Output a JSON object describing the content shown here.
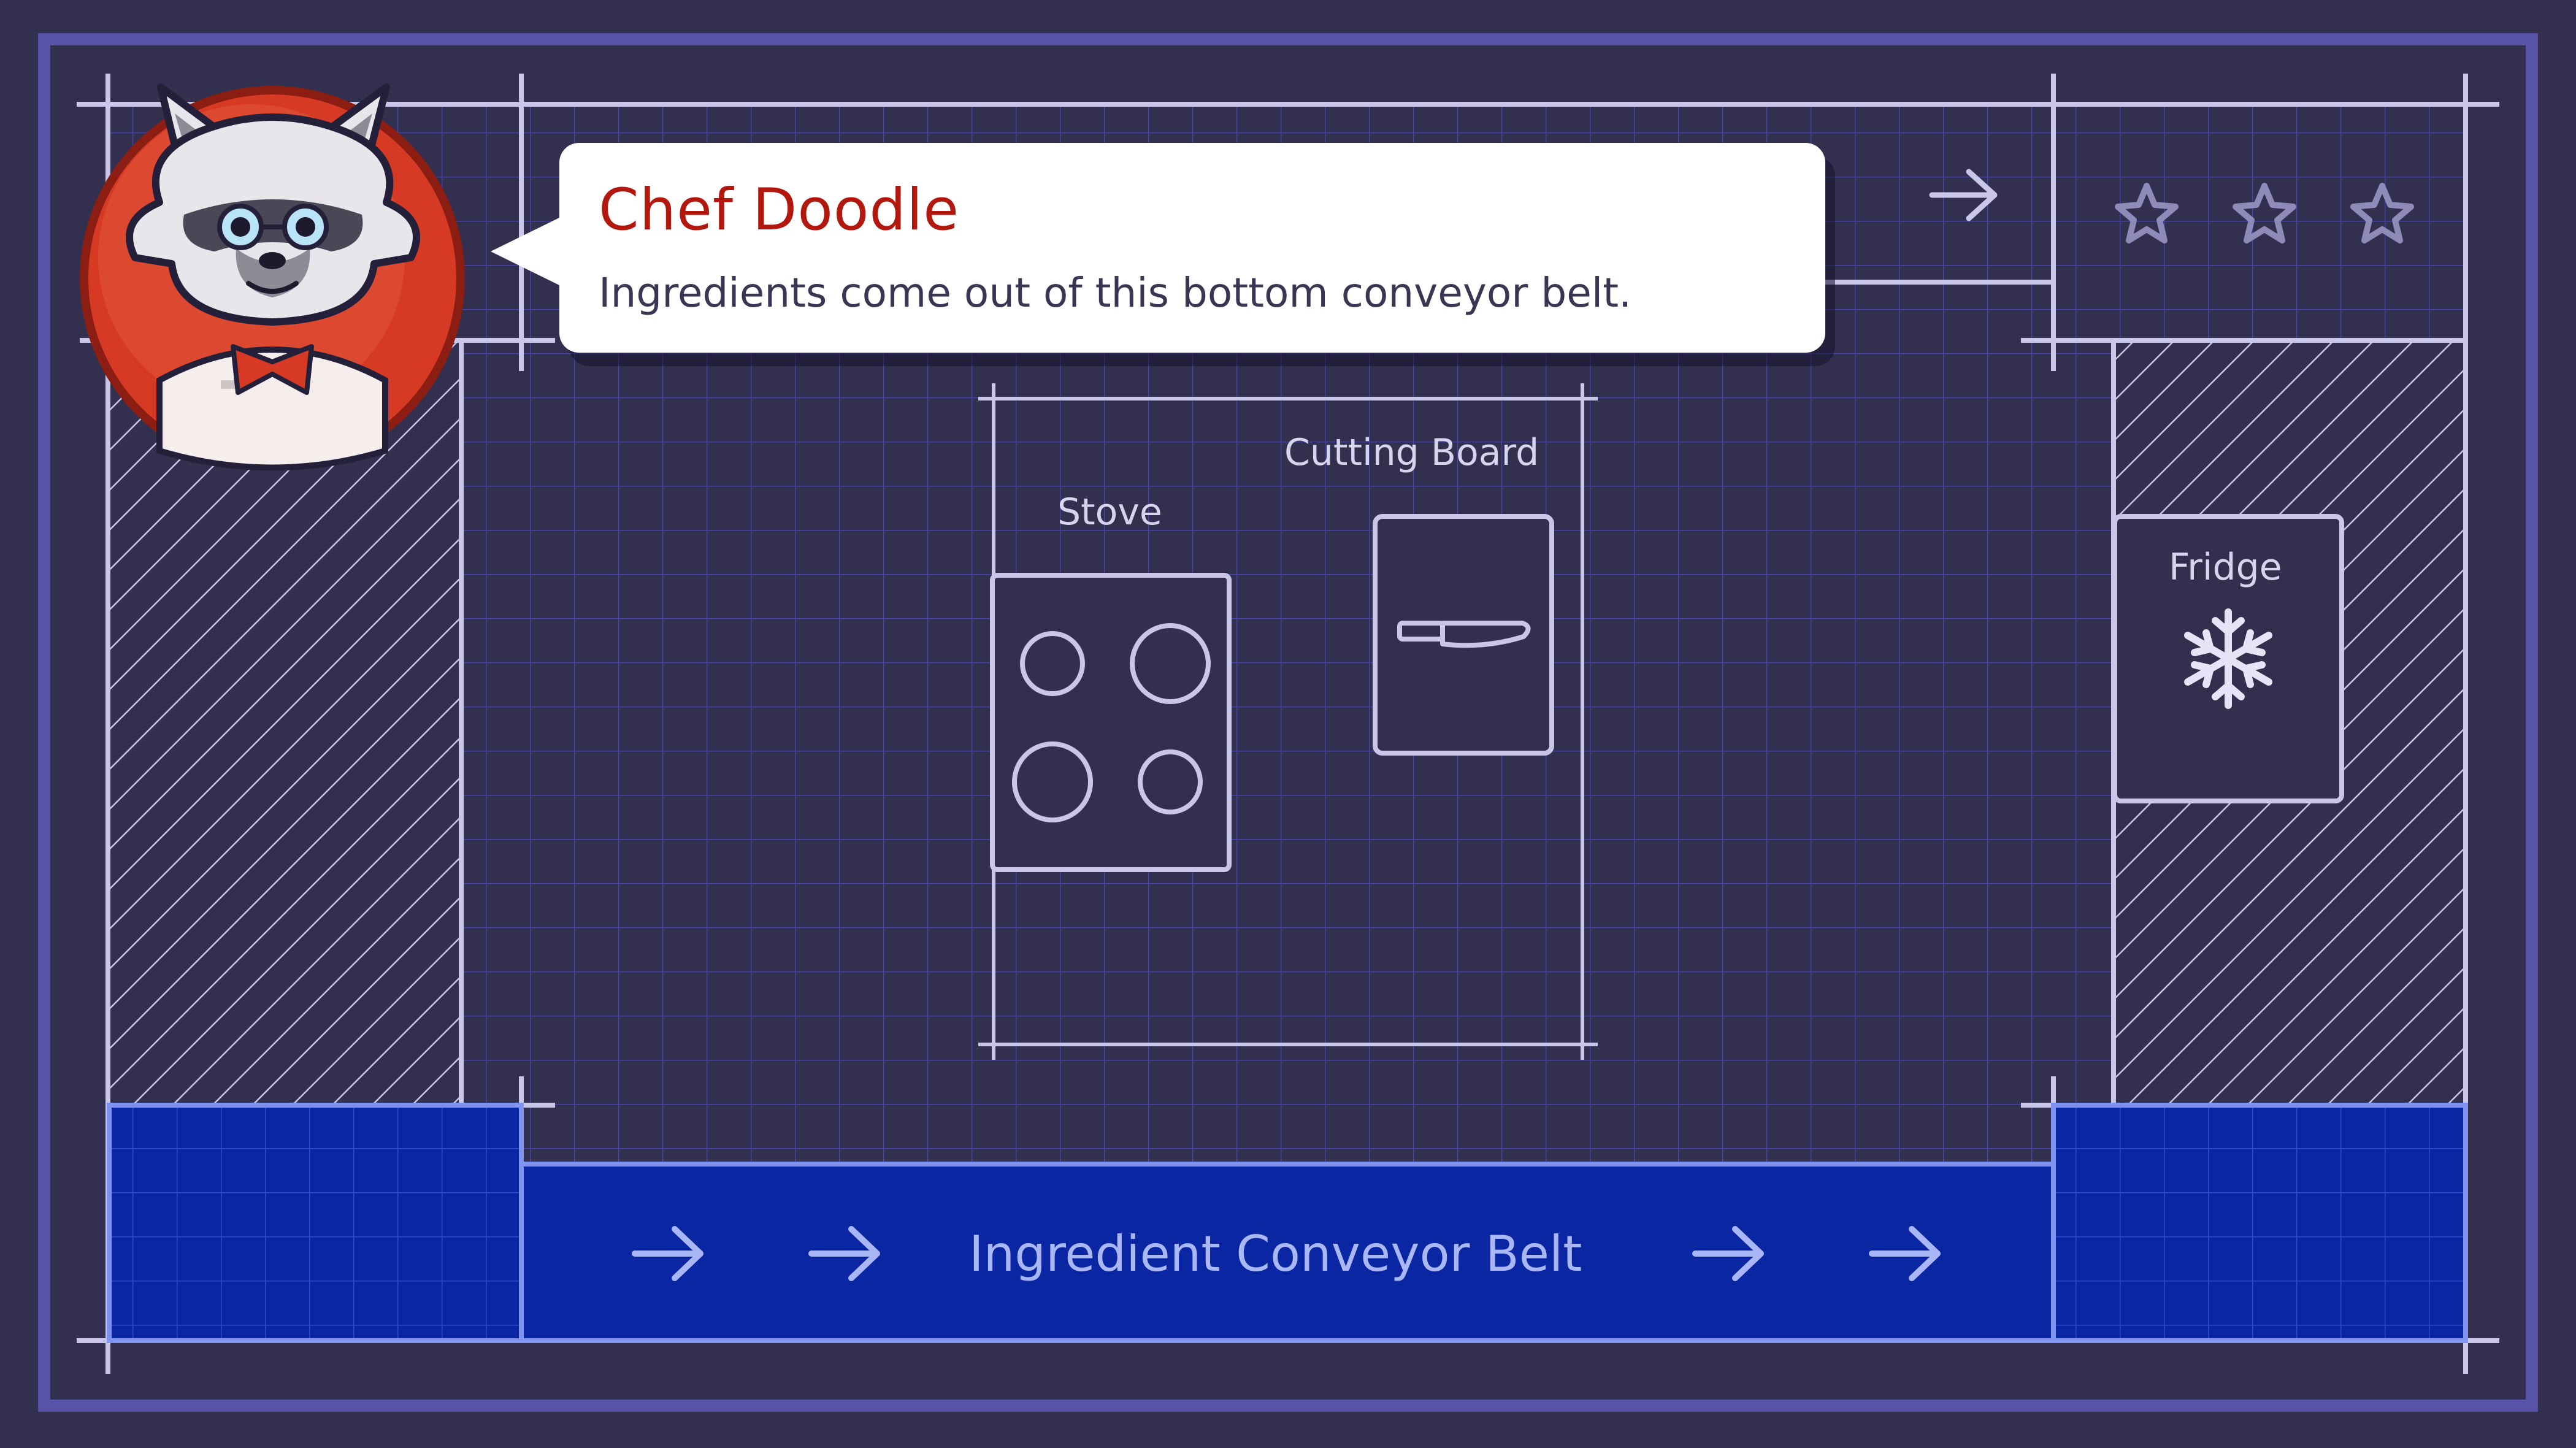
{
  "dialogue": {
    "speaker": "Chef Doodle",
    "text": "Ingredients come out of this bottom conveyor belt."
  },
  "stations": {
    "stove": "Stove",
    "cutting_board": "Cutting Board",
    "fridge": "Fridge"
  },
  "conveyor": {
    "label": "Ingredient Conveyor Belt"
  },
  "rating": {
    "stars_filled": 0,
    "stars_total": 3
  },
  "colors": {
    "background": "#32304e",
    "line": "#c9c6ea",
    "grid": "#4a47a3",
    "conveyor": "#0b26a3",
    "speaker_name": "#b3180f",
    "avatar_ring": "#d63a24"
  },
  "icons": {
    "star": "star-outline-icon",
    "snowflake": "snowflake-icon",
    "knife": "knife-icon",
    "arrow": "arrow-right-icon"
  }
}
